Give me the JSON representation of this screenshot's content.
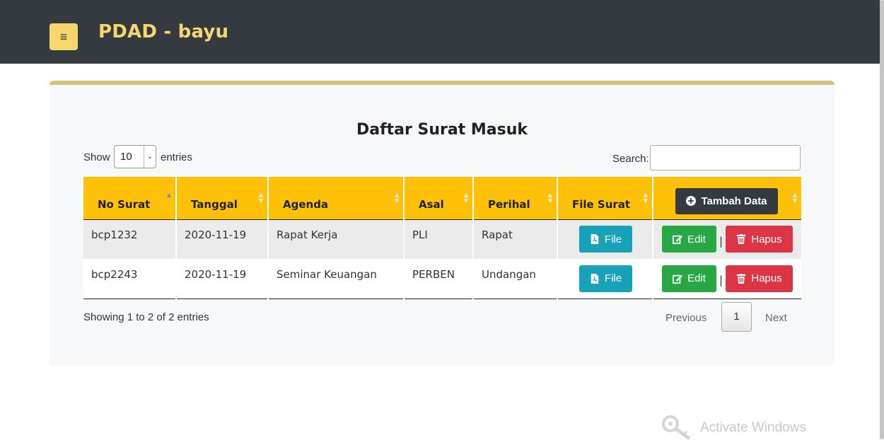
{
  "header": {
    "menu_icon": "hamburger-icon",
    "brand": "PDAD - bayu",
    "colors": {
      "bar": "#343a40",
      "accent": "#f5d76e"
    }
  },
  "card": {
    "title": "Daftar Surat Masuk",
    "accent": "#d8c07a"
  },
  "controls": {
    "show_label": "Show",
    "length_value": "10",
    "entries_label": "entries",
    "search_label": "Search:",
    "search_value": ""
  },
  "table": {
    "columns": [
      "No Surat",
      "Tanggal",
      "Agenda",
      "Asal",
      "Perihal",
      "File Surat"
    ],
    "add_button": "Tambah Data",
    "header_color": "#ffc107",
    "rows": [
      {
        "no_surat": "bcp1232",
        "tanggal": "2020-11-19",
        "agenda": "Rapat Kerja",
        "asal": "PLI",
        "perihal": "Rapat"
      },
      {
        "no_surat": "bcp2243",
        "tanggal": "2020-11-19",
        "agenda": "Seminar Keuangan",
        "asal": "PERBEN",
        "perihal": "Undangan"
      }
    ],
    "file_label": "File",
    "edit_label": "Edit",
    "hapus_label": "Hapus",
    "separator": "|",
    "button_colors": {
      "file": "#17a2b8",
      "edit": "#28a745",
      "hapus": "#dc3545",
      "tambah": "#343a40"
    }
  },
  "footer": {
    "info": "Showing 1 to 2 of 2 entries",
    "previous": "Previous",
    "page": "1",
    "next": "Next"
  },
  "watermark": {
    "text": "Activate Windows",
    "icon": "key-icon"
  }
}
